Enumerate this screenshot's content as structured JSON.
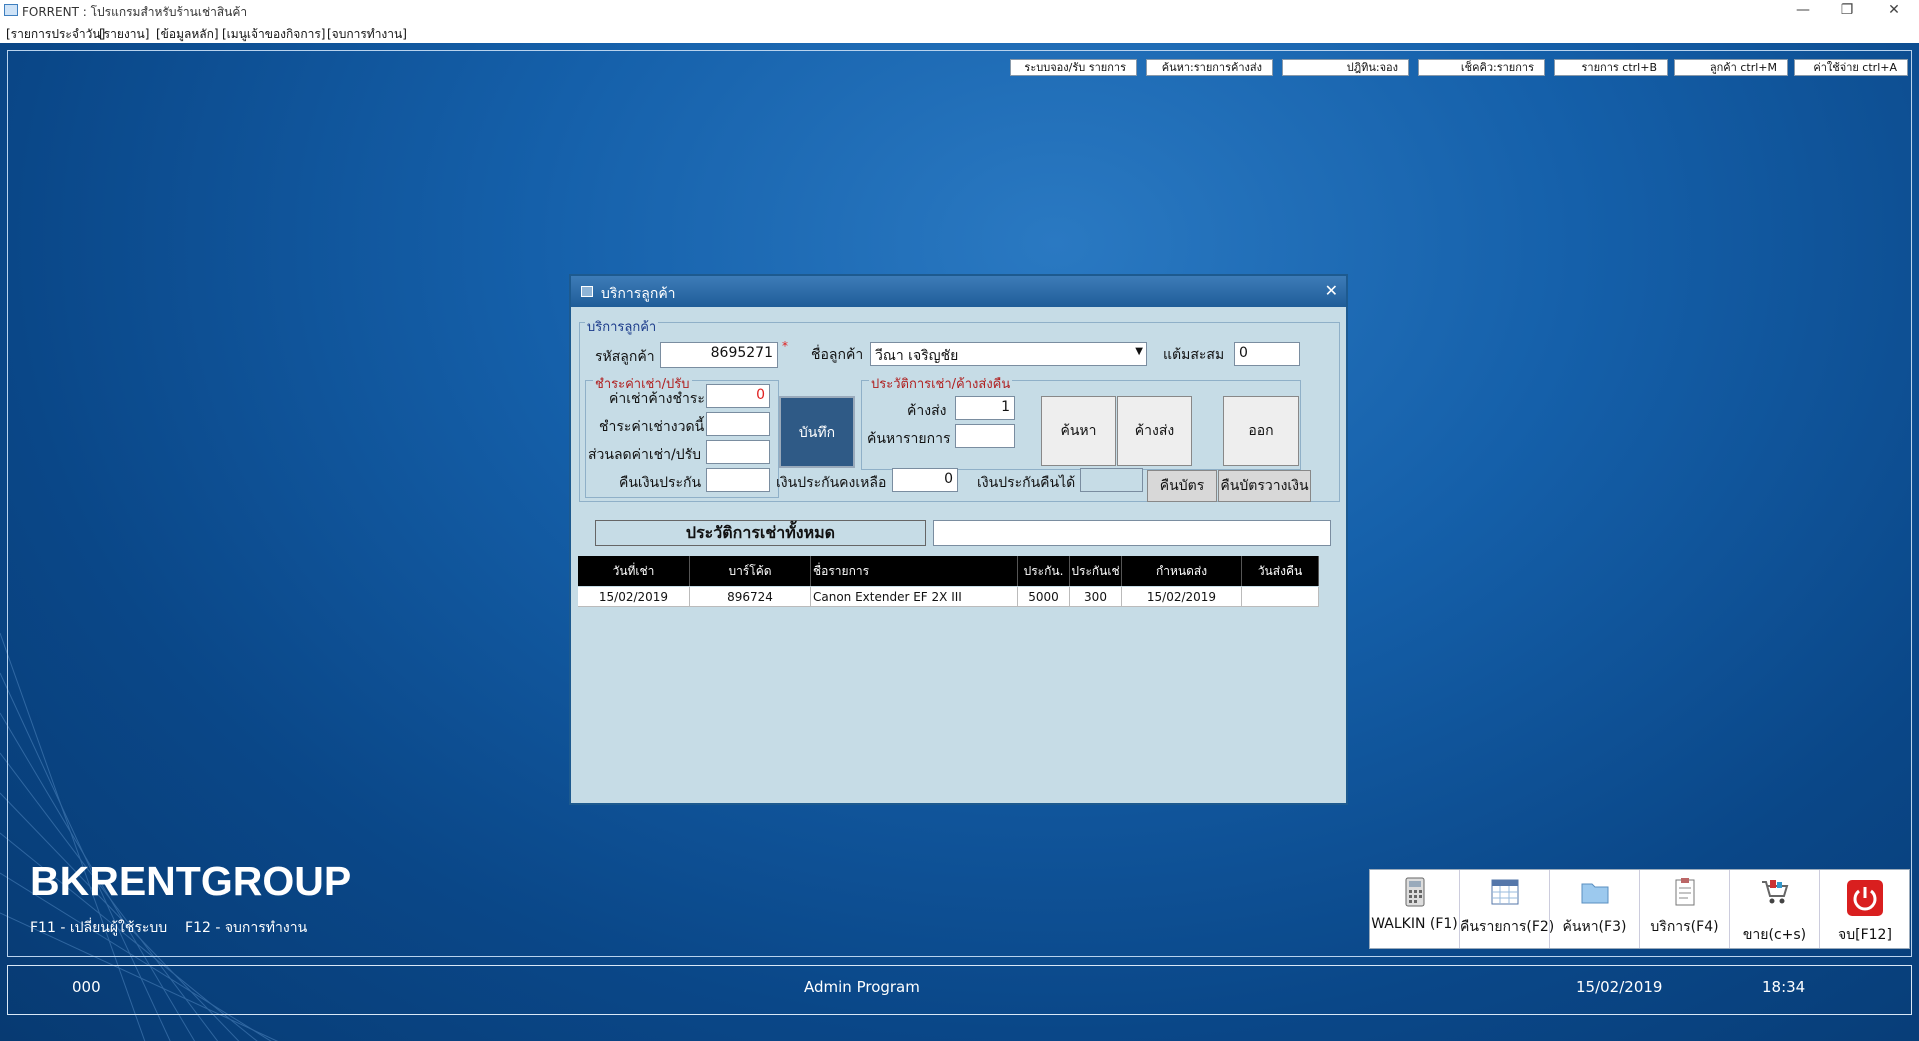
{
  "window": {
    "title": "FORRENT : โปรแกรมสำหรับร้านเช่าสินค้า",
    "minimize": "—",
    "restore": "❐",
    "close": "✕"
  },
  "menu": [
    "[รายการประจำวัน]",
    "[รายงาน]",
    "[ข้อมูลหลัก]",
    "[เมนูเจ้าของกิจการ]",
    "[จบการทำงาน]"
  ],
  "toolbar": [
    "ระบบจอง/รับ รายการ",
    "ค้นหา:รายการค้างส่ง",
    "ปฎิทิน:จอง",
    "เช็คคิว:รายการ",
    "รายการ ctrl+B",
    "ลูกค้า ctrl+M",
    "ค่าใช้จ่าย ctrl+A"
  ],
  "brand": {
    "name": "BKRENTGROUP",
    "hint1": "F11 - เปลี่ยนผู้ใช้ระบบ",
    "hint2": "F12 - จบการทำงาน"
  },
  "status": {
    "code": "000",
    "program": "Admin Program",
    "date": "15/02/2019",
    "time": "18:34"
  },
  "dock": [
    {
      "label": "WALKIN  (F1)",
      "icon": "calculator-icon"
    },
    {
      "label": "คืนรายการ(F2)",
      "icon": "calendar-icon"
    },
    {
      "label": "ค้นหา(F3)",
      "icon": "folder-icon"
    },
    {
      "label": "บริการ(F4)",
      "icon": "clipboard-icon"
    },
    {
      "label": "ขาย(c+s)",
      "icon": "cart-icon"
    },
    {
      "label": "จบ[F12]",
      "icon": "power-icon"
    }
  ],
  "dialog": {
    "title": "บริการลูกค้า",
    "group_customer": "บริการลูกค้า",
    "customer_code_label": "รหัสลูกค้า",
    "customer_code": "8695271",
    "required_mark": "*",
    "customer_name_label": "ชื่อลูกค้า",
    "customer_name": "วีณา  เจริญชัย",
    "points_label": "แต้มสะสม",
    "points": "0",
    "pay_group": "ชำระค่าเช่า/ปรับ",
    "outstanding_label": "ค่าเช่าค้างชำระ",
    "outstanding": "0",
    "pay_now_label": "ชำระค่าเช่างวดนี้",
    "discount_label": "ส่วนลดค่าเช่า/ปรับ",
    "refund_label": "คืนเงินประกัน",
    "save_button": "บันทึก",
    "history_group": "ประวัติการเช่า/ค้างส่งคืน",
    "pending_label": "ค้างส่ง",
    "pending": "1",
    "search_item_label": "ค้นหารายการ",
    "search_button": "ค้นหา",
    "pending_button": "ค้างส่ง",
    "exit_button": "ออก",
    "deposit_left_label": "เงินประกันคงเหลือ",
    "deposit_left": "0",
    "deposit_refundable_label": "เงินประกันคืนได้",
    "return_card_button": "คืนบัตร",
    "return_card_deposit_button": "คืนบัตรวางเงิน",
    "history_all_label": "ประวัติการเช่าทั้งหมด",
    "grid_headers": [
      "วันที่เช่า",
      "บาร์โค้ด",
      "ชื่อรายการ",
      "ประกัน.",
      "ประกันเช่",
      "กำหนดส่ง",
      "วันส่งคืน"
    ],
    "grid_rows": [
      [
        "15/02/2019",
        "896724",
        "Canon Extender EF 2X III",
        "5000",
        "300",
        "15/02/2019",
        ""
      ]
    ]
  },
  "colors": {
    "desktop": "#0b4f93",
    "dialog_bg": "#c6dce6",
    "save_button": "#2f5a86",
    "accent_red": "#e02020"
  }
}
